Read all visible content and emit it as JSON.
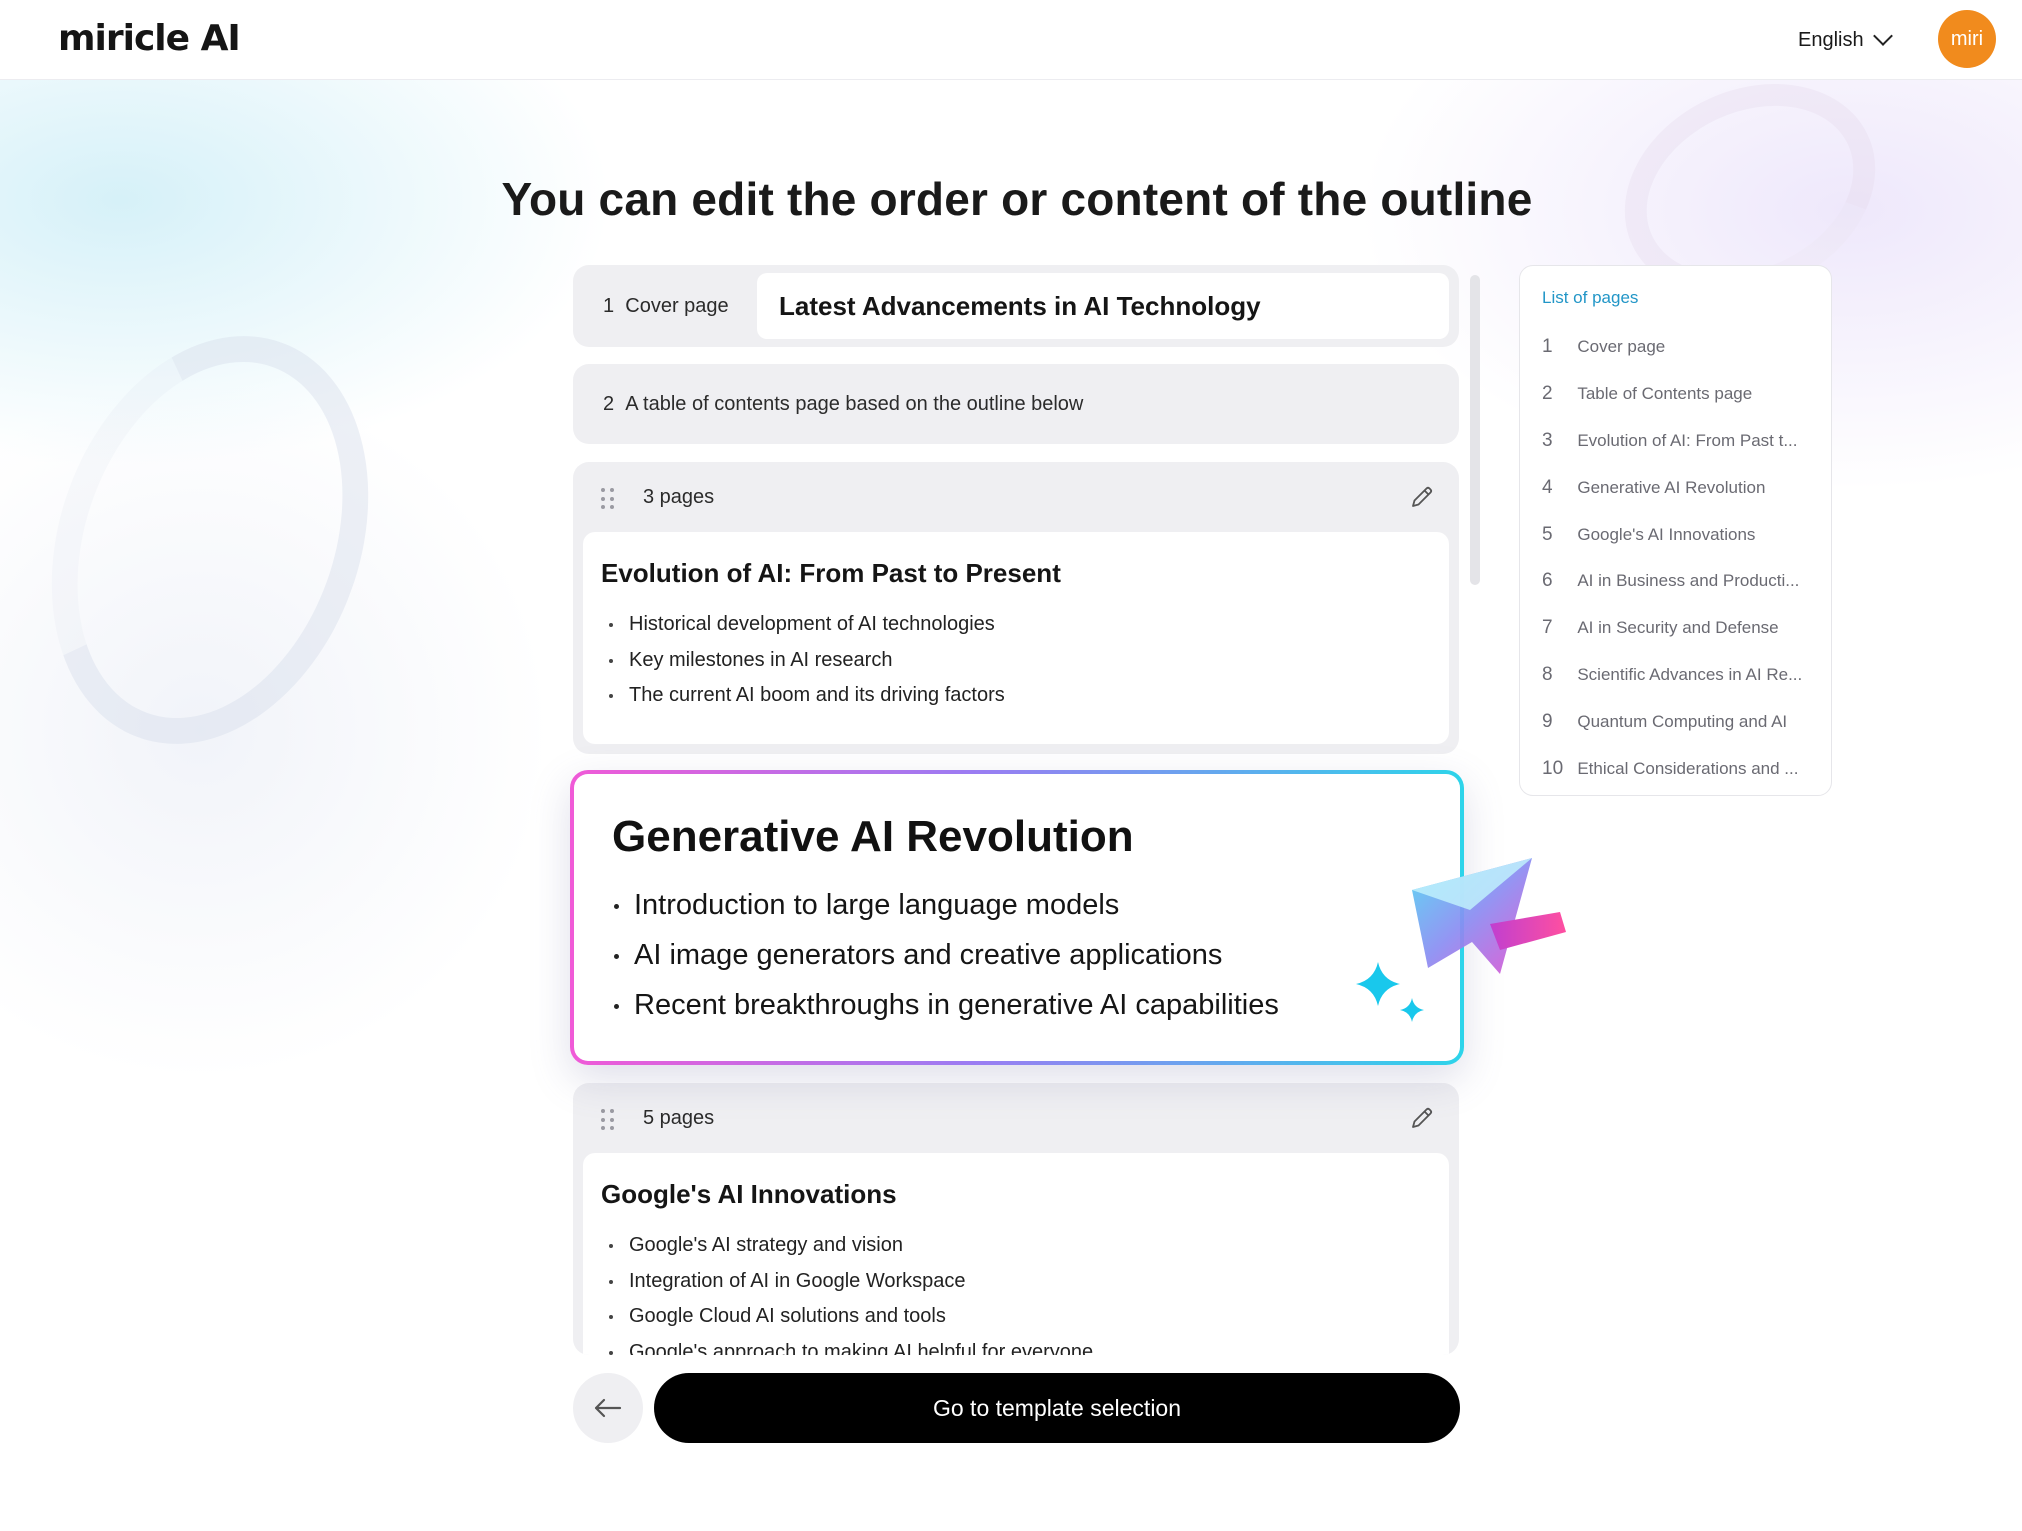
{
  "header": {
    "logo": "miricle AI",
    "language": "English",
    "avatar_text": "miri"
  },
  "page_title": "You can edit the order or content of the outline",
  "outline": {
    "cover": {
      "number": "1",
      "label": "Cover page",
      "value": "Latest Advancements in AI Technology"
    },
    "toc": {
      "number": "2",
      "label": "A table of contents page based on the outline below"
    },
    "sections": [
      {
        "pages": "3 pages",
        "title": "Evolution of AI: From Past to Present",
        "bullets": [
          "Historical development of AI technologies",
          "Key milestones in AI research",
          "The current AI boom and its driving factors"
        ]
      },
      {
        "title": "Generative AI Revolution",
        "bullets": [
          "Introduction to large language models",
          "AI image generators and creative applications",
          "Recent breakthroughs in generative AI capabilities"
        ]
      },
      {
        "pages": "5 pages",
        "title": "Google's AI Innovations",
        "bullets": [
          "Google's AI strategy and vision",
          "Integration of AI in Google Workspace",
          "Google Cloud AI solutions and tools",
          "Google's approach to making AI helpful for everyone"
        ]
      }
    ]
  },
  "list_of_pages": {
    "title": "List of pages",
    "items": [
      {
        "n": "1",
        "label": "Cover page"
      },
      {
        "n": "2",
        "label": "Table of Contents page"
      },
      {
        "n": "3",
        "label": "Evolution of AI: From Past t..."
      },
      {
        "n": "4",
        "label": "Generative AI Revolution"
      },
      {
        "n": "5",
        "label": "Google's AI Innovations"
      },
      {
        "n": "6",
        "label": "AI in Business and Producti..."
      },
      {
        "n": "7",
        "label": "AI in Security and Defense"
      },
      {
        "n": "8",
        "label": "Scientific Advances in AI Re..."
      },
      {
        "n": "9",
        "label": "Quantum Computing and AI"
      },
      {
        "n": "10",
        "label": "Ethical Considerations and ..."
      }
    ]
  },
  "actions": {
    "back_icon": "arrow-left-icon",
    "primary_label": "Go to template selection"
  },
  "colors": {
    "accent_blue": "#2296c7",
    "avatar_orange": "#f18b1d",
    "gradient_pink": "#f05ad7",
    "gradient_cyan": "#2dd4ea",
    "button_black": "#000000"
  }
}
